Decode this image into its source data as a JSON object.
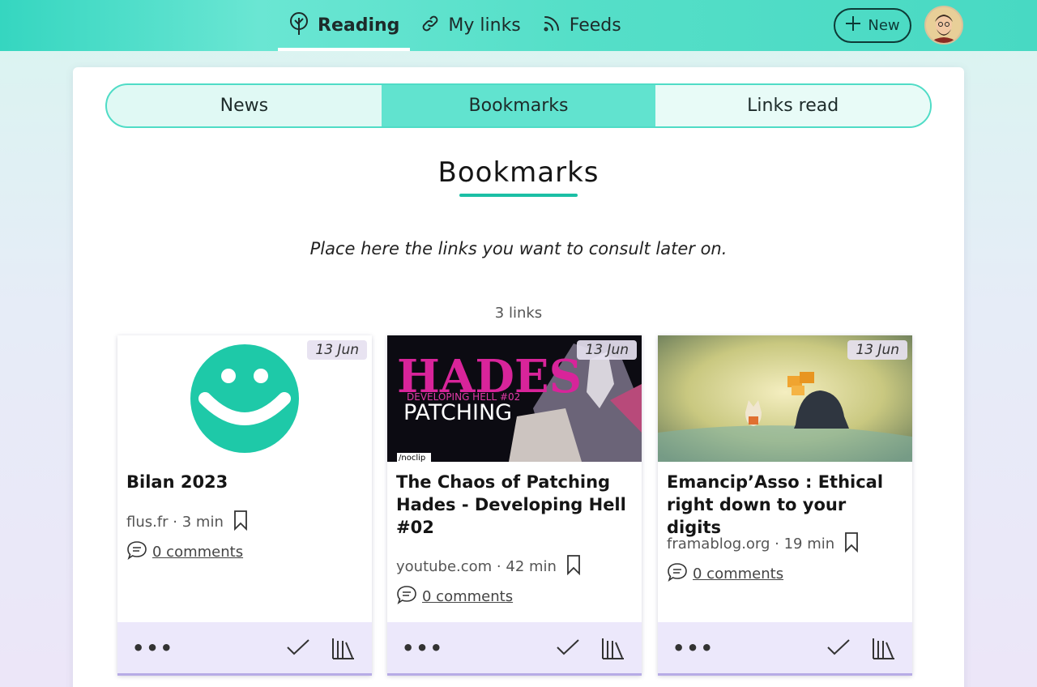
{
  "header": {
    "nav": [
      {
        "label": "Reading",
        "icon": "tree-icon",
        "active": true
      },
      {
        "label": "My links",
        "icon": "link-icon",
        "active": false
      },
      {
        "label": "Feeds",
        "icon": "rss-icon",
        "active": false
      }
    ],
    "new_label": "New"
  },
  "tabs": [
    "News",
    "Bookmarks",
    "Links read"
  ],
  "page": {
    "title": "Bookmarks",
    "intro": "Place here the links you want to consult later on.",
    "count": "3 links"
  },
  "links": [
    {
      "date": "13 Jun",
      "title": "Bilan 2023",
      "source": "flus.fr · 3 min",
      "comments": "0 comments"
    },
    {
      "date": "13 Jun",
      "title": "The Chaos of Patching Hades - Developing Hell #02",
      "source": "youtube.com · 42 min",
      "comments": "0 comments",
      "thumb_text": {
        "big": "HADES",
        "sub": "DEVELOPING HELL #02",
        "word": "PATCHING",
        "tag": "/noclip"
      }
    },
    {
      "date": "13 Jun",
      "title": "Emancip’Asso : Ethical right down to your digits",
      "source": "framablog.org · 19 min",
      "comments": "0 comments"
    }
  ],
  "colors": {
    "accent": "#4fdcc6",
    "accent_dark": "#1bbfa5",
    "footer": "#ece8fb"
  }
}
